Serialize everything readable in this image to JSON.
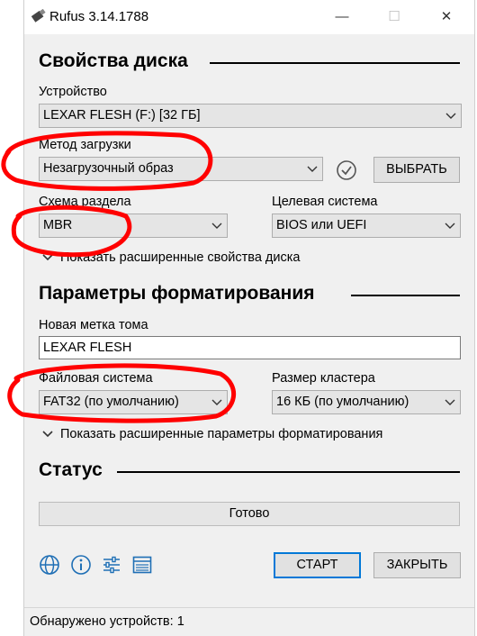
{
  "window": {
    "title": "Rufus 3.14.1788"
  },
  "drive_properties": {
    "header": "Свойства диска",
    "device_label": "Устройство",
    "device_value": "LEXAR FLESH (F:) [32 ГБ]",
    "boot_label": "Метод загрузки",
    "boot_value": "Незагрузочный образ",
    "select_button": "ВЫБРАТЬ",
    "partition_label": "Схема раздела",
    "partition_value": "MBR",
    "target_label": "Целевая система",
    "target_value": "BIOS или UEFI",
    "advanced_toggle": "Показать расширенные свойства диска"
  },
  "format_options": {
    "header": "Параметры форматирования",
    "volume_label_label": "Новая метка тома",
    "volume_label_value": "LEXAR FLESH",
    "fs_label": "Файловая система",
    "fs_value": "FAT32 (по умолчанию)",
    "cluster_label": "Размер кластера",
    "cluster_value": "16 КБ (по умолчанию)",
    "advanced_toggle": "Показать расширенные параметры форматирования"
  },
  "status": {
    "header": "Статус",
    "progress_text": "Готово"
  },
  "actions": {
    "start": "СТАРТ",
    "close": "ЗАКРЫТЬ"
  },
  "statusbar": {
    "text": "Обнаружено устройств: 1"
  },
  "icons": [
    "globe-icon",
    "info-icon",
    "settings-sliders-icon",
    "log-icon",
    "check-icon",
    "chevron-down-icon"
  ],
  "colors": {
    "accent": "#0078d7",
    "annotation": "#ff0000",
    "icon_blue": "#1f6fb5"
  }
}
